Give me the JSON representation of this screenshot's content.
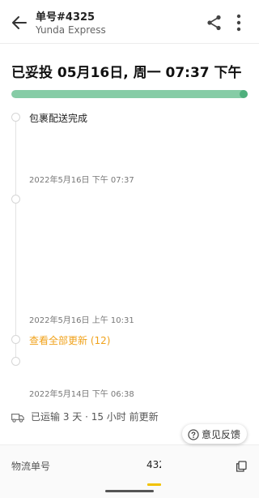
{
  "header": {
    "title": "单号#4325",
    "subtitle": "Yunda Express"
  },
  "status": {
    "delivered_text": "已妥投 05月16日, 周一 07:37 下午",
    "progress_percent": 100,
    "progress_color": "#86cca6"
  },
  "timeline": {
    "events": [
      {
        "text": "包裹配送完成",
        "time": "2022年5月16日 下午 07:37"
      },
      {
        "text": "",
        "time": "2022年5月16日 上午 10:31"
      },
      {
        "text": "",
        "time": "2022年5月14日 下午 06:38"
      }
    ],
    "view_all_label": "查看全部更新 (12)"
  },
  "transit": {
    "text": "已运输 3 天 · 15 小时 前更新",
    "icon": "truck-icon"
  },
  "feedback": {
    "label": "意见反馈",
    "icon": "question-circle-icon"
  },
  "bottom": {
    "tracking_label": "物流单号",
    "tracking_value": "4325",
    "copy_icon": "copy-icon",
    "accent_color": "#f2c200"
  },
  "colors": {
    "link": "#f0a21b"
  }
}
